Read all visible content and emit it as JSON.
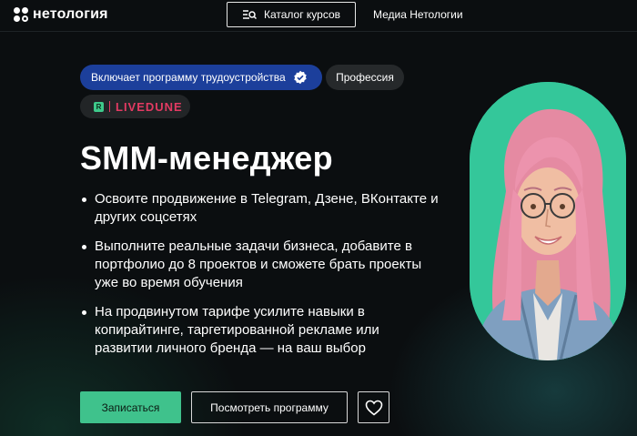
{
  "header": {
    "logo_text": "нетология",
    "catalog_label": "Каталог курсов",
    "media_label": "Медиа Нетологии"
  },
  "badges": {
    "employment": "Включает программу трудоустройства",
    "profession": "Профессия",
    "partner_icon_letter": "R",
    "partner_name": "LIVEDUNE"
  },
  "hero": {
    "title": "SMM-менеджер",
    "bullets": [
      "Освоите продвижение в Telegram, Дзене, ВКонтакте и других соцсетях",
      "Выполните реальные задачи бизнеса, добавите в портфолио до 8 проектов и сможете брать проекты уже во время обучения",
      "На продвинутом тарифе усилите навыки в копирайтинге, таргетированной рекламе или развитии личного бренда — на ваш выбор"
    ]
  },
  "actions": {
    "enroll_label": "Записаться",
    "program_label": "Посмотреть программу",
    "favorite_icon": "heart-icon"
  },
  "icons": {
    "logo": "netology-logo-icon",
    "catalog": "menu-search-icon",
    "verified": "check-badge-icon"
  },
  "colors": {
    "background": "#0b0e10",
    "accent_green": "#3fc28c",
    "employment_badge": "#1c3f9b",
    "partner_red": "#e23a62",
    "portrait_bg": "#34c79a"
  }
}
